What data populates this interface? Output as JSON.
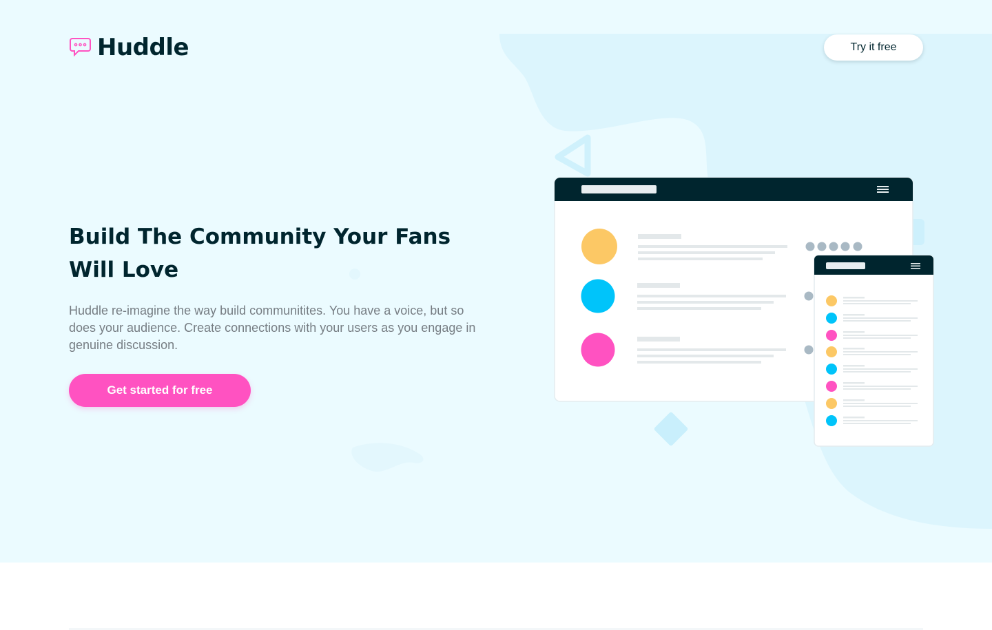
{
  "header": {
    "logo_text": "Huddle",
    "logo_icon": "speech-bubble-icon",
    "try_button_label": "Try it free"
  },
  "hero": {
    "headline_line1": "Build The Community Your Fans",
    "headline_line2": "Will Love",
    "description": "Huddle re-imagine the way build communitites. You have a voice, but so does your audience. Create connections with your users as you engage in genuine discussion.",
    "cta_label": "Get started for free"
  },
  "illustration": {
    "desktop_avatar_colors": [
      "#fcc865",
      "#00c4fa",
      "#ff52c1"
    ],
    "mobile_avatar_colors": [
      "#fcc865",
      "#00c4fa",
      "#ff52c1",
      "#fcc865",
      "#00c4fa",
      "#ff52c1",
      "#fcc865",
      "#00c4fa"
    ]
  },
  "colors": {
    "hero_bg": "#ebfbff",
    "primary_dark": "#00252e",
    "accent_pink": "#ff52c1",
    "text_gray": "#767d83"
  }
}
